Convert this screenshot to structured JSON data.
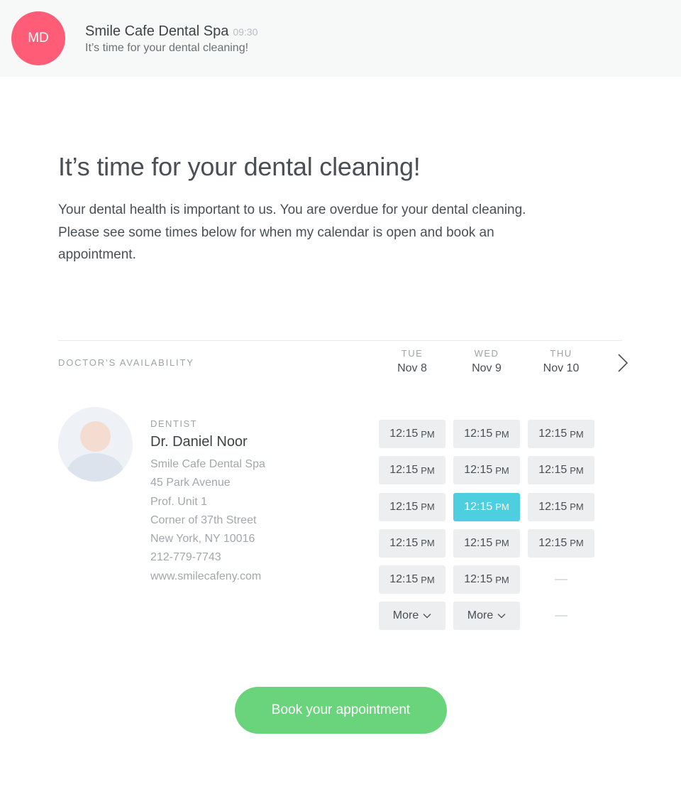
{
  "notification": {
    "avatar_initials": "MD",
    "sender": "Smile Cafe Dental Spa",
    "time": "09:30",
    "preview": "It’s time for your dental cleaning!"
  },
  "message": {
    "headline": "It’s time for your dental cleaning!",
    "body": "Your dental health is important to us. You are overdue for your dental cleaning. Please see some times below for when my calendar is open and book an appointment."
  },
  "availability": {
    "label": "DOCTOR’S AVAILABILITY",
    "next_icon": "chevron-right-icon",
    "days": [
      {
        "dow": "TUE",
        "date": "Nov 8"
      },
      {
        "dow": "WED",
        "date": "Nov 9"
      },
      {
        "dow": "THU",
        "date": "Nov 10"
      }
    ]
  },
  "doctor": {
    "role": "DENTIST",
    "name": "Dr. Daniel Noor",
    "practice": "Smile Cafe Dental Spa",
    "address1": "45 Park Avenue",
    "address2": "Prof. Unit 1",
    "address3": "Corner of 37th Street",
    "city": "New York, NY 10016",
    "phone": "212-779-7743",
    "website": "www.smilecafeny.com"
  },
  "slots": {
    "ampm": "PM",
    "more_label": "More",
    "columns": [
      {
        "times": [
          "12:15",
          "12:15",
          "12:15",
          "12:15",
          "12:15"
        ],
        "more": true
      },
      {
        "times": [
          "12:15",
          "12:15",
          "12:15",
          "12:15",
          "12:15"
        ],
        "more": true,
        "selected_index": 2
      },
      {
        "times": [
          "12:15",
          "12:15",
          "12:15",
          "12:15"
        ],
        "more": false
      }
    ]
  },
  "cta": {
    "label": "Book your appointment"
  },
  "colors": {
    "avatar": "#ff5c78",
    "selected_slot": "#4ecfe0",
    "cta": "#6ad47c"
  }
}
